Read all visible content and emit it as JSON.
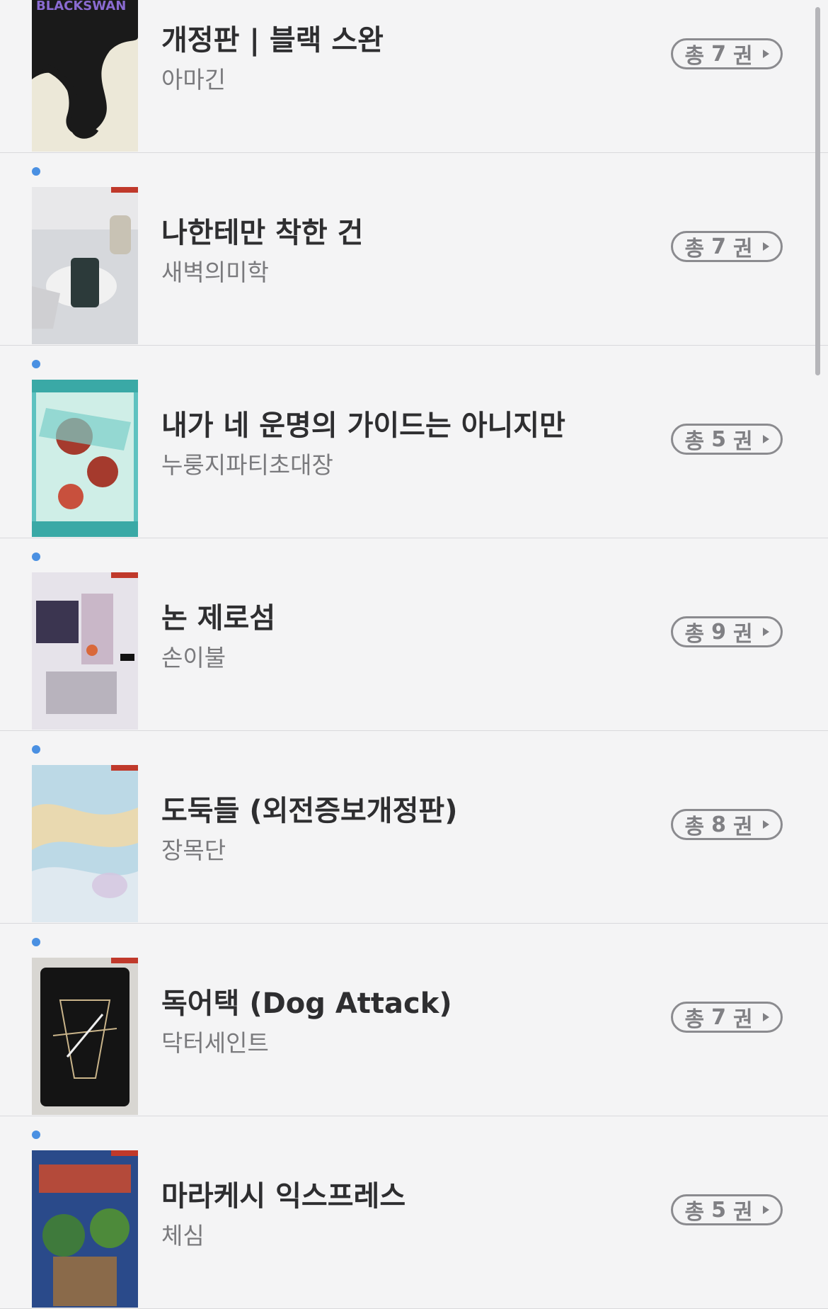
{
  "books": [
    {
      "title": "개정판 | 블랙 스완",
      "author": "아마긴",
      "count_prefix": "총",
      "count": "7",
      "count_unit": "권",
      "has_dot": false,
      "cover_icon": "book-cover-image"
    },
    {
      "title": "나한테만 착한 건",
      "author": "새벽의미학",
      "count_prefix": "총",
      "count": "7",
      "count_unit": "권",
      "has_dot": true,
      "cover_icon": "book-cover-image"
    },
    {
      "title": "내가 네 운명의 가이드는 아니지만",
      "author": "누룽지파티초대장",
      "count_prefix": "총",
      "count": "5",
      "count_unit": "권",
      "has_dot": true,
      "cover_icon": "book-cover-image"
    },
    {
      "title": "논 제로섬",
      "author": "손이불",
      "count_prefix": "총",
      "count": "9",
      "count_unit": "권",
      "has_dot": true,
      "cover_icon": "book-cover-image"
    },
    {
      "title": "도둑들 (외전증보개정판)",
      "author": "장목단",
      "count_prefix": "총",
      "count": "8",
      "count_unit": "권",
      "has_dot": true,
      "cover_icon": "book-cover-image"
    },
    {
      "title": "독어택 (Dog Attack)",
      "author": "닥터세인트",
      "count_prefix": "총",
      "count": "7",
      "count_unit": "권",
      "has_dot": true,
      "cover_icon": "book-cover-image"
    },
    {
      "title": "마라케시 익스프레스",
      "author": "체심",
      "count_prefix": "총",
      "count": "5",
      "count_unit": "권",
      "has_dot": true,
      "cover_icon": "book-cover-image"
    }
  ],
  "colors": {
    "background": "#f4f4f5",
    "new_dot": "#4a90e2",
    "title": "#2e2e30",
    "author": "#7a7a7d",
    "badge": "#808084"
  }
}
